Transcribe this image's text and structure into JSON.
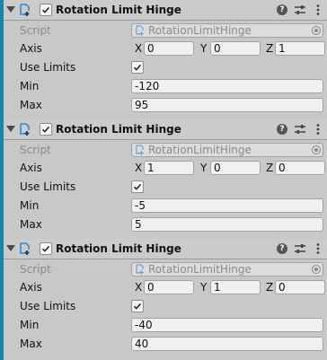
{
  "components": [
    {
      "title": "Rotation Limit Hinge",
      "enabled": true,
      "script_label": "Script",
      "script_value": "RotationLimitHinge",
      "axis_label": "Axis",
      "axis": {
        "x_label": "X",
        "x": "0",
        "y_label": "Y",
        "y": "0",
        "z_label": "Z",
        "z": "1"
      },
      "use_limits_label": "Use Limits",
      "use_limits": true,
      "min_label": "Min",
      "min": "-120",
      "max_label": "Max",
      "max": "95"
    },
    {
      "title": "Rotation Limit Hinge",
      "enabled": true,
      "script_label": "Script",
      "script_value": "RotationLimitHinge",
      "axis_label": "Axis",
      "axis": {
        "x_label": "X",
        "x": "1",
        "y_label": "Y",
        "y": "0",
        "z_label": "Z",
        "z": "0"
      },
      "use_limits_label": "Use Limits",
      "use_limits": true,
      "min_label": "Min",
      "min": "-5",
      "max_label": "Max",
      "max": "5"
    },
    {
      "title": "Rotation Limit Hinge",
      "enabled": true,
      "script_label": "Script",
      "script_value": "RotationLimitHinge",
      "axis_label": "Axis",
      "axis": {
        "x_label": "X",
        "x": "0",
        "y_label": "Y",
        "y": "1",
        "z_label": "Z",
        "z": "0"
      },
      "use_limits_label": "Use Limits",
      "use_limits": true,
      "min_label": "Min",
      "min": "-40",
      "max_label": "Max",
      "max": "40"
    }
  ],
  "icons": {
    "foldout": "chevron-down-icon",
    "component": "script-icon",
    "help": "help-icon",
    "preset": "preset-icon",
    "menu": "kebab-menu-icon",
    "object_picker": "target-icon"
  },
  "colors": {
    "accent_strip": "#1a86a7",
    "script_icon": "#2a8fd8",
    "background": "#c8c8c8"
  }
}
